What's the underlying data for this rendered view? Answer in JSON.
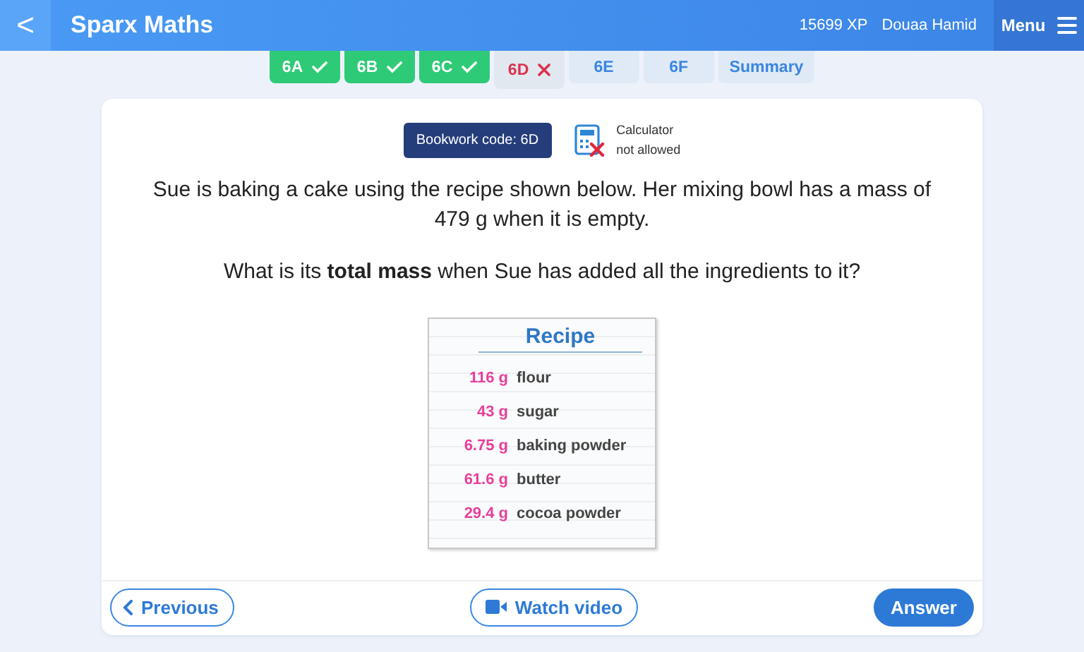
{
  "header": {
    "back": "<",
    "title": "Sparx Maths",
    "xp": "15699 XP",
    "user": "Douaa Hamid",
    "menu": "Menu"
  },
  "tabs": [
    {
      "label": "6A",
      "kind": "correct",
      "selected": false
    },
    {
      "label": "6B",
      "kind": "correct",
      "selected": false
    },
    {
      "label": "6C",
      "kind": "correct",
      "selected": false
    },
    {
      "label": "6D",
      "kind": "wrong",
      "selected": true
    },
    {
      "label": "6E",
      "kind": "plain",
      "selected": false
    },
    {
      "label": "6F",
      "kind": "plain",
      "selected": false
    },
    {
      "label": "Summary",
      "kind": "plain",
      "selected": false
    }
  ],
  "question": {
    "bookwork_code": "Bookwork code: 6D",
    "calculator": {
      "allowed": false,
      "label": "Calculator",
      "note": "not allowed"
    },
    "text": "Sue is baking a cake using the recipe shown below. Her mixing bowl has a mass of 479 g when it is empty.",
    "prompt": "What is its **total mass** when Sue has added all the ingredients to it?",
    "recipe": {
      "title": "Recipe",
      "items": [
        {
          "amount": "116 g",
          "ingredient": "flour"
        },
        {
          "amount": "43 g",
          "ingredient": "sugar"
        },
        {
          "amount": "6.75 g",
          "ingredient": "baking powder"
        },
        {
          "amount": "61.6 g",
          "ingredient": "butter"
        },
        {
          "amount": "29.4 g",
          "ingredient": "cocoa powder"
        }
      ]
    }
  },
  "footer": {
    "previous": "Previous",
    "watch_video": "Watch video",
    "answer": "Answer"
  }
}
